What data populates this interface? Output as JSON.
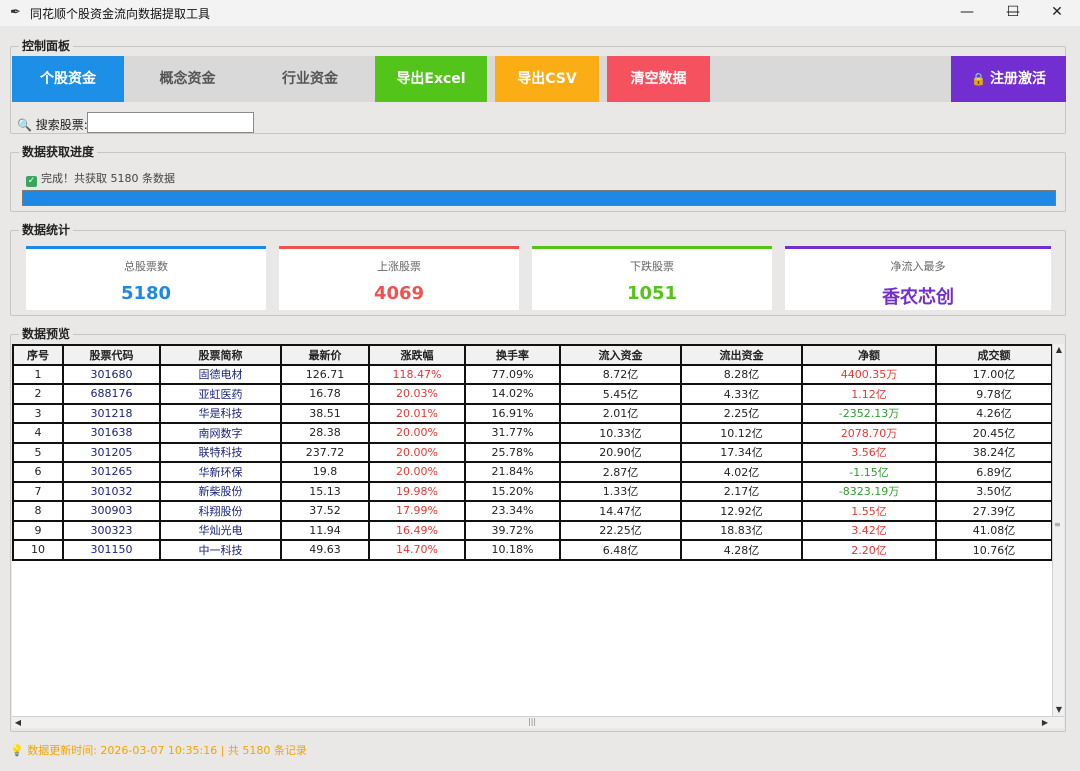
{
  "window": {
    "title": "同花顺个股资金流向数据提取工具",
    "minimize": "—",
    "maximize": "☐",
    "close": "✕"
  },
  "control_panel": {
    "title": "控制面板",
    "buttons": [
      {
        "label": "个股资金",
        "color": "#1e8fe6",
        "text_color": "#ffffff"
      },
      {
        "label": "概念资金",
        "color": "#d9d9d9",
        "text_color": "#555555"
      },
      {
        "label": "行业资金",
        "color": "#d9d9d9",
        "text_color": "#555555"
      },
      {
        "label": "导出Excel",
        "color": "#52c41a",
        "text_color": "#ffffff"
      },
      {
        "label": "导出CSV",
        "color": "#faad14",
        "text_color": "#ffffff"
      },
      {
        "label": "清空数据",
        "color": "#f5515f",
        "text_color": "#ffffff"
      }
    ],
    "register": {
      "label": "注册激活",
      "color": "#722ed1"
    },
    "search_label": "搜索股票:",
    "search_value": ""
  },
  "progress": {
    "title": "数据获取进度",
    "status": "完成！共获取 5180 条数据",
    "percent": 100
  },
  "stats": {
    "title": "数据统计",
    "cards": [
      {
        "label": "总股票数",
        "value": "5180",
        "color": "#1e88e5"
      },
      {
        "label": "上涨股票",
        "value": "4069",
        "color": "#ef5350"
      },
      {
        "label": "下跌股票",
        "value": "1051",
        "color": "#52c41a"
      },
      {
        "label": "净流入最多",
        "value": "香农芯创",
        "color": "#722ed1"
      }
    ]
  },
  "preview": {
    "title": "数据预览",
    "columns": [
      "序号",
      "股票代码",
      "股票简称",
      "最新价",
      "涨跌幅",
      "换手率",
      "流入资金",
      "流出资金",
      "净额",
      "成交额"
    ],
    "rows": [
      {
        "idx": "1",
        "code": "301680",
        "name": "固德电材",
        "price": "126.71",
        "change": "118.47%",
        "turnover": "77.09%",
        "inflow": "8.72亿",
        "outflow": "8.28亿",
        "net": "4400.35万",
        "net_dir": "up",
        "amount": "17.00亿"
      },
      {
        "idx": "2",
        "code": "688176",
        "name": "亚虹医药",
        "price": "16.78",
        "change": "20.03%",
        "turnover": "14.02%",
        "inflow": "5.45亿",
        "outflow": "4.33亿",
        "net": "1.12亿",
        "net_dir": "up",
        "amount": "9.78亿"
      },
      {
        "idx": "3",
        "code": "301218",
        "name": "华是科技",
        "price": "38.51",
        "change": "20.01%",
        "turnover": "16.91%",
        "inflow": "2.01亿",
        "outflow": "2.25亿",
        "net": "-2352.13万",
        "net_dir": "down",
        "amount": "4.26亿"
      },
      {
        "idx": "4",
        "code": "301638",
        "name": "南网数字",
        "price": "28.38",
        "change": "20.00%",
        "turnover": "31.77%",
        "inflow": "10.33亿",
        "outflow": "10.12亿",
        "net": "2078.70万",
        "net_dir": "up",
        "amount": "20.45亿"
      },
      {
        "idx": "5",
        "code": "301205",
        "name": "联特科技",
        "price": "237.72",
        "change": "20.00%",
        "turnover": "25.78%",
        "inflow": "20.90亿",
        "outflow": "17.34亿",
        "net": "3.56亿",
        "net_dir": "up",
        "amount": "38.24亿"
      },
      {
        "idx": "6",
        "code": "301265",
        "name": "华新环保",
        "price": "19.8",
        "change": "20.00%",
        "turnover": "21.84%",
        "inflow": "2.87亿",
        "outflow": "4.02亿",
        "net": "-1.15亿",
        "net_dir": "down",
        "amount": "6.89亿"
      },
      {
        "idx": "7",
        "code": "301032",
        "name": "新柴股份",
        "price": "15.13",
        "change": "19.98%",
        "turnover": "15.20%",
        "inflow": "1.33亿",
        "outflow": "2.17亿",
        "net": "-8323.19万",
        "net_dir": "down",
        "amount": "3.50亿"
      },
      {
        "idx": "8",
        "code": "300903",
        "name": "科翔股份",
        "price": "37.52",
        "change": "17.99%",
        "turnover": "23.34%",
        "inflow": "14.47亿",
        "outflow": "12.92亿",
        "net": "1.55亿",
        "net_dir": "up",
        "amount": "27.39亿"
      },
      {
        "idx": "9",
        "code": "300323",
        "name": "华灿光电",
        "price": "11.94",
        "change": "16.49%",
        "turnover": "39.72%",
        "inflow": "22.25亿",
        "outflow": "18.83亿",
        "net": "3.42亿",
        "net_dir": "up",
        "amount": "41.08亿"
      },
      {
        "idx": "10",
        "code": "301150",
        "name": "中一科技",
        "price": "49.63",
        "change": "14.70%",
        "turnover": "10.18%",
        "inflow": "6.48亿",
        "outflow": "4.28亿",
        "net": "2.20亿",
        "net_dir": "up",
        "amount": "10.76亿"
      }
    ]
  },
  "status_bar": "数据更新时间: 2026-03-07 10:35:16 | 共 5180 条记录",
  "icons": {
    "app": "feather-icon",
    "search": "magnifier-icon",
    "check": "checkmark-icon",
    "register": "lock-icon",
    "status": "lightbulb-icon"
  }
}
